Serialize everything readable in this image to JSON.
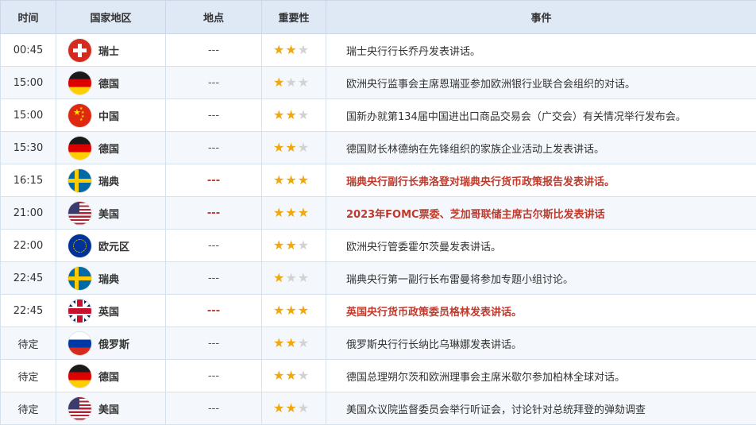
{
  "header": {
    "time": "时间",
    "country": "国家地区",
    "location": "地点",
    "importance": "重要性",
    "event": "事件"
  },
  "rows": [
    {
      "time": "00:45",
      "country": "瑞士",
      "flag": "switzerland-flag-icon",
      "location": "---",
      "stars": 2,
      "event": "瑞士央行行长乔丹发表讲话。",
      "highlight": false
    },
    {
      "time": "15:00",
      "country": "德国",
      "flag": "germany-flag-icon",
      "location": "---",
      "stars": 1,
      "event": "欧洲央行监事会主席恩瑞亚参加欧洲银行业联合会组织的对话。",
      "highlight": false
    },
    {
      "time": "15:00",
      "country": "中国",
      "flag": "china-flag-icon",
      "location": "---",
      "stars": 2,
      "event": "国新办就第134届中国进出口商品交易会（广交会）有关情况举行发布会。",
      "highlight": false
    },
    {
      "time": "15:30",
      "country": "德国",
      "flag": "germany-flag-icon",
      "location": "---",
      "stars": 2,
      "event": "德国财长林德纳在先锋组织的家族企业活动上发表讲话。",
      "highlight": false
    },
    {
      "time": "16:15",
      "country": "瑞典",
      "flag": "sweden-flag-icon",
      "location": "---",
      "stars": 3,
      "event": "瑞典央行副行长弗洛登对瑞典央行货币政策报告发表讲话。",
      "highlight": true
    },
    {
      "time": "21:00",
      "country": "美国",
      "flag": "usa-flag-icon",
      "location": "---",
      "stars": 3,
      "event": "2023年FOMC票委、芝加哥联储主席古尔斯比发表讲话",
      "highlight": true
    },
    {
      "time": "22:00",
      "country": "欧元区",
      "flag": "eu-flag-icon",
      "location": "---",
      "stars": 2,
      "event": "欧洲央行管委霍尔茨曼发表讲话。",
      "highlight": false
    },
    {
      "time": "22:45",
      "country": "瑞典",
      "flag": "sweden-flag-icon",
      "location": "---",
      "stars": 1,
      "event": "瑞典央行第一副行长布雷曼将参加专题小组讨论。",
      "highlight": false
    },
    {
      "time": "22:45",
      "country": "英国",
      "flag": "uk-flag-icon",
      "location": "---",
      "stars": 3,
      "event": "英国央行货币政策委员格林发表讲话。",
      "highlight": true
    },
    {
      "time": "待定",
      "country": "俄罗斯",
      "flag": "russia-flag-icon",
      "location": "---",
      "stars": 2,
      "event": "俄罗斯央行行长纳比乌琳娜发表讲话。",
      "highlight": false
    },
    {
      "time": "待定",
      "country": "德国",
      "flag": "germany-flag-icon",
      "location": "---",
      "stars": 2,
      "event": "德国总理朔尔茨和欧洲理事会主席米歇尔参加柏林全球对话。",
      "highlight": false
    },
    {
      "time": "待定",
      "country": "美国",
      "flag": "usa-flag-icon",
      "location": "---",
      "stars": 2,
      "event": "美国众议院监督委员会举行听证会，讨论针对总统拜登的弹劾调查",
      "highlight": false
    }
  ],
  "colors": {
    "highlight": "#c0392b",
    "star_on": "#f0a80f",
    "star_off": "#d2d2d2",
    "header_bg": "#dfe9f5"
  }
}
